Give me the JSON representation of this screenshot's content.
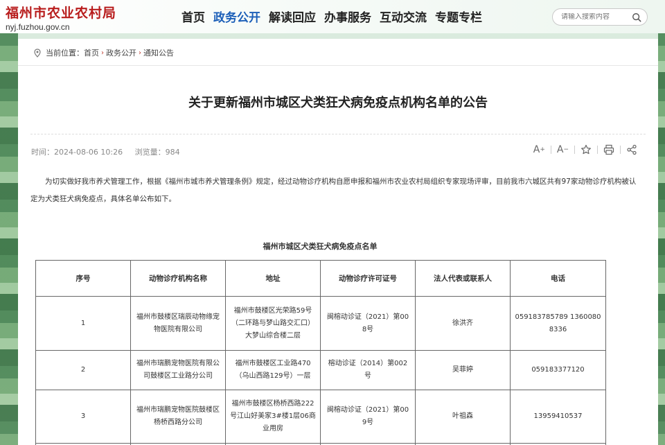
{
  "site": {
    "title": "福州市农业农村局",
    "url": "nyj.fuzhou.gov.cn"
  },
  "nav": [
    "首页",
    "政务公开",
    "解读回应",
    "办事服务",
    "互动交流",
    "专题专栏"
  ],
  "search": {
    "placeholder": "请输入搜索内容"
  },
  "breadcrumb": {
    "prefix": "当前位置：",
    "items": [
      "首页",
      "政务公开",
      "通知公告"
    ],
    "separator": "›"
  },
  "article": {
    "title": "关于更新福州市城区犬类狂犬病免疫点机构名单的公告",
    "time_label": "时间：",
    "time": "2024-08-06 10:26",
    "views_label": "浏览量：",
    "views": "984",
    "tools": {
      "font_increase": "A+",
      "font_decrease": "A-"
    },
    "paragraph": "为切实做好我市养犬管理工作，根据《福州市城市养犬管理条例》规定，经过动物诊疗机构自愿申报和福州市农业农村局组织专家现场评审，目前我市六城区共有97家动物诊疗机构被认定为犬类狂犬病免疫点，具体名单公布如下。",
    "table_caption": "福州市城区犬类狂犬病免疫点名单"
  },
  "table": {
    "headers": [
      "序号",
      "动物诊疗机构名称",
      "地址",
      "动物诊疗许可证号",
      "法人代表或联系人",
      "电话"
    ],
    "rows": [
      [
        "1",
        "福州市鼓楼区瑞辰动物缘宠物医院有限公司",
        "福州市鼓楼区光荣路59号（二环路与梦山路交汇口）大梦山综合楼二层",
        "闽榕动诊证（2021）第008号",
        "徐洪齐",
        "059183785789 13600808336"
      ],
      [
        "2",
        "福州市瑞鹏宠物医院有限公司鼓楼区工业路分公司",
        "福州市鼓楼区工业路470（乌山西路129号）一层",
        "榕动诊证（2014）第002号",
        "吴菲婷",
        "059183377120"
      ],
      [
        "3",
        "福州市瑞鹏宠物医院鼓楼区杨桥西路分公司",
        "福州市鼓楼区杨桥西路222号江山好美家3#楼1层06商业用房",
        "闽榕动诊证（2021）第009号",
        "叶祖森",
        "13959410537"
      ],
      [
        "",
        "",
        "",
        "",
        "",
        ""
      ]
    ]
  },
  "colors": {
    "brand_red": "#b81c1c",
    "nav_active": "#1c5fb8"
  }
}
